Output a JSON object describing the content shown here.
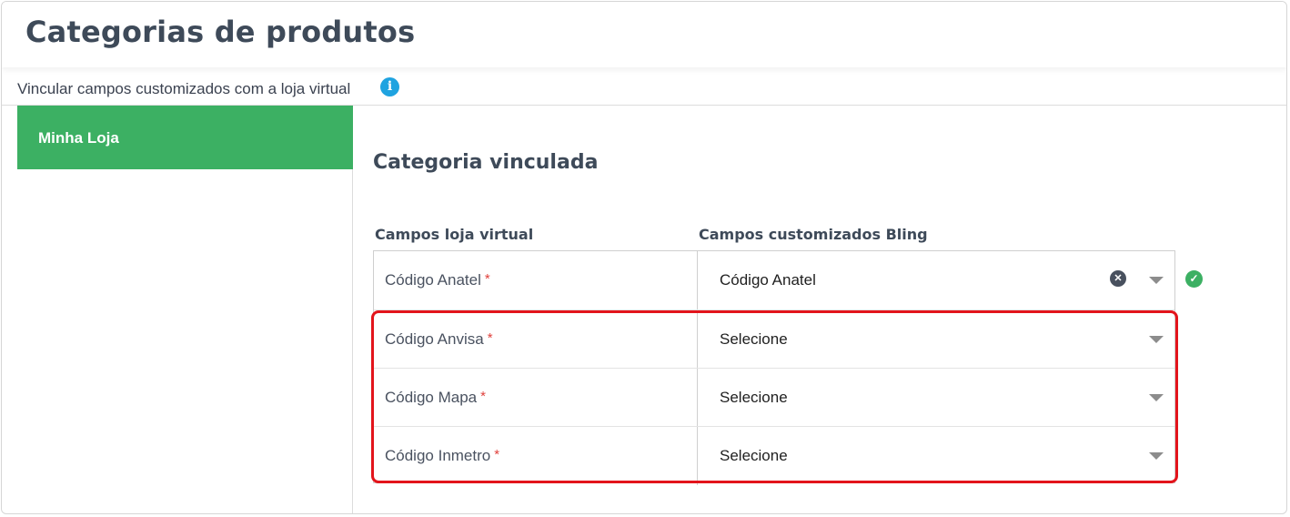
{
  "header": {
    "title": "Categorias de produtos"
  },
  "subheader": {
    "text": "Vincular campos customizados com a loja virtual",
    "info_icon": "info-icon"
  },
  "sidebar": {
    "items": [
      {
        "label": "Minha Loja",
        "active": true
      }
    ]
  },
  "main": {
    "section_title": "Categoria vinculada",
    "columns": {
      "left": "Campos loja virtual",
      "right": "Campos customizados Bling"
    },
    "rows": [
      {
        "label": "Código Anatel",
        "required_mark": "*",
        "value": "Código Anatel",
        "clearable": true,
        "status": "check-icon"
      },
      {
        "label": "Código Anvisa",
        "required_mark": "*",
        "value": "Selecione"
      },
      {
        "label": "Código Mapa",
        "required_mark": "*",
        "value": "Selecione"
      },
      {
        "label": "Código Inmetro",
        "required_mark": "*",
        "value": "Selecione"
      }
    ]
  },
  "colors": {
    "accent_green": "#3cb063",
    "title_text": "#3e4a59",
    "info_blue": "#1fa3e0",
    "required_red": "#e0413c",
    "highlight_red": "#e3141b"
  }
}
